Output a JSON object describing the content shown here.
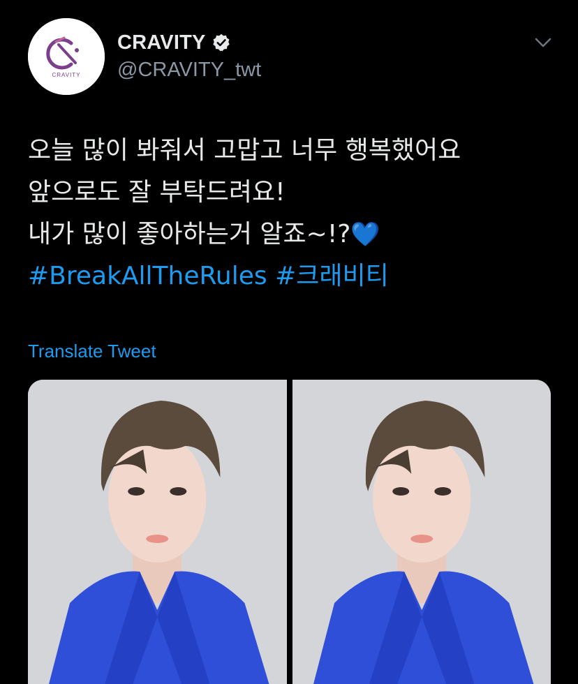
{
  "tweet": {
    "author": {
      "display_name": "CRAVITY",
      "handle": "@CRAVITY_twt",
      "avatar_logo_text": "CRAVITY",
      "verified": true
    },
    "text_lines": [
      "오늘 많이 봐줘서 고맙고 너무 행복했어요",
      "앞으로도 잘 부탁드려요!",
      "내가 많이 좋아하는거 알죠~!?"
    ],
    "emoji": "💙",
    "hashtags": [
      "#BreakAllTheRules",
      "#크래비티"
    ],
    "translate_label": "Translate Tweet",
    "media": [
      {
        "type": "photo",
        "subject": "person-in-blue-suit"
      },
      {
        "type": "photo",
        "subject": "person-in-blue-suit"
      }
    ]
  },
  "icons": {
    "verified": "verified-badge-icon",
    "more": "chevron-down-icon"
  },
  "colors": {
    "background": "#000000",
    "text_primary": "#e7e9ea",
    "text_secondary": "#8b98a5",
    "link": "#1d9bf0",
    "logo_purple": "#7b3f8c",
    "suit_blue": "#2f4fd8"
  }
}
